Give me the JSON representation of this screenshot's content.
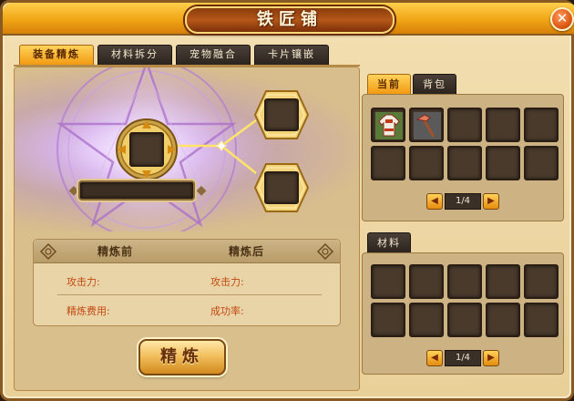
{
  "window": {
    "title": "铁匠铺",
    "close_glyph": "✕"
  },
  "tabs": [
    {
      "label": "装备精炼",
      "active": true
    },
    {
      "label": "材料拆分",
      "active": false
    },
    {
      "label": "宠物融合",
      "active": false
    },
    {
      "label": "卡片镶嵌",
      "active": false
    }
  ],
  "refine": {
    "before_label": "精炼前",
    "after_label": "精炼后",
    "attack_before": "攻击力:",
    "cost": "精炼费用:",
    "attack_after": "攻击力:",
    "success_rate": "成功率:",
    "button": "精炼"
  },
  "inventory": {
    "tabs": [
      {
        "label": "当前",
        "active": true
      },
      {
        "label": "背包",
        "active": false
      }
    ],
    "items": [
      "armor-icon",
      "staff-icon"
    ],
    "page": "1/4"
  },
  "materials": {
    "tab": "材料",
    "page": "1/4"
  },
  "colors": {
    "accent": "#f29a12",
    "slot": "#4a3a2c",
    "stat_text": "#c24a12"
  }
}
